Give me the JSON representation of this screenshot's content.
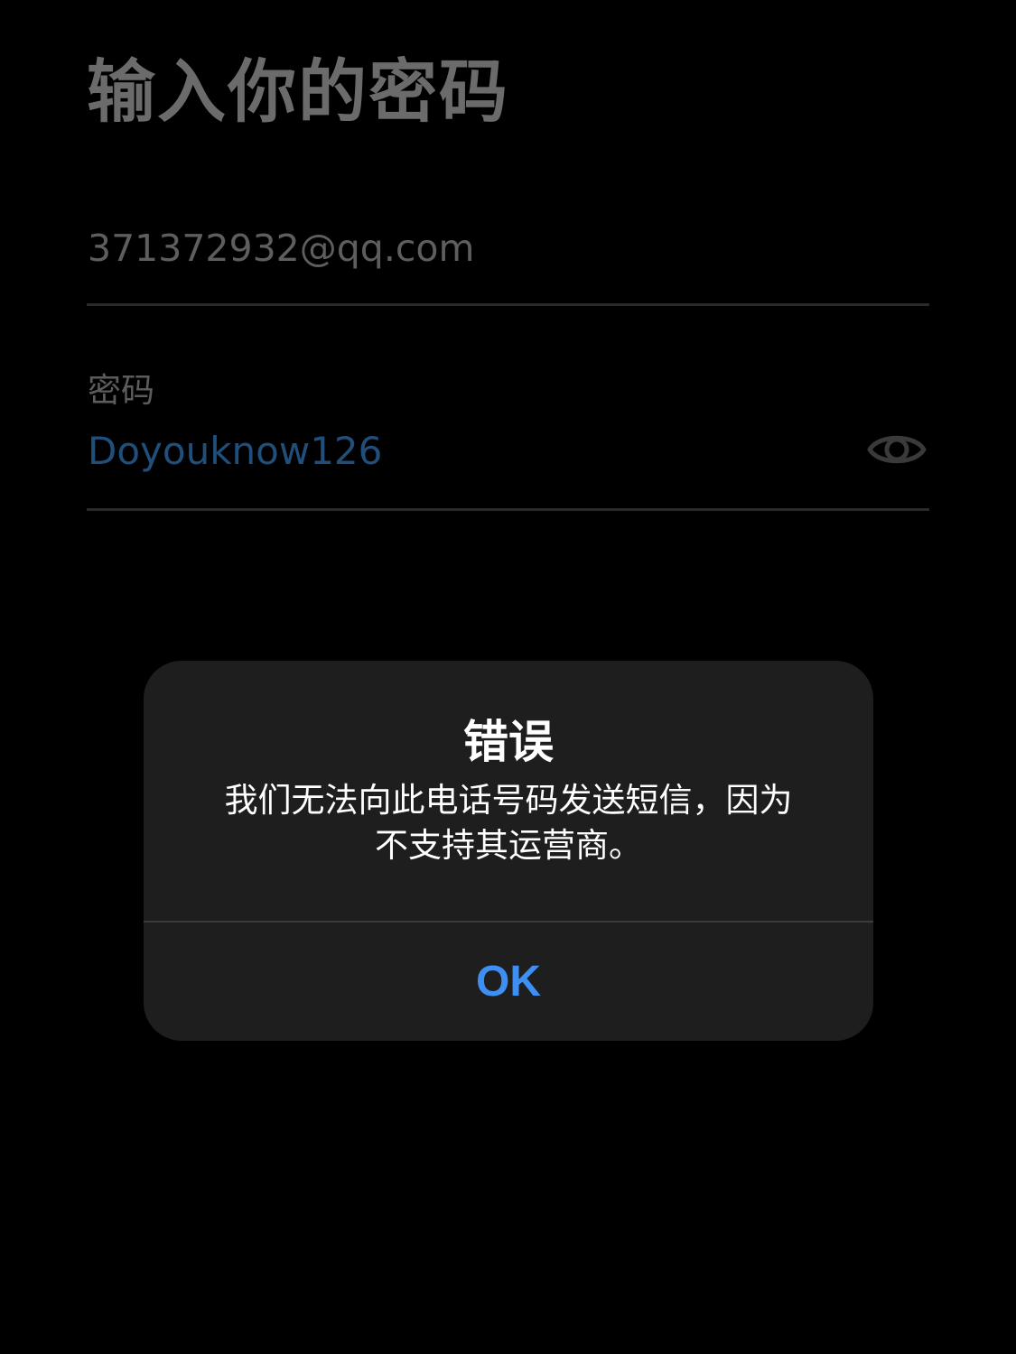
{
  "page": {
    "title": "输入你的密码"
  },
  "login": {
    "email_value": "371372932@qq.com",
    "password_label": "密码",
    "password_value": "Doyouknow126",
    "visibility_icon": "eye-icon"
  },
  "alert": {
    "title": "错误",
    "message_line1": "我们无法向此电话号码发送短信，因为",
    "message_line2": "不支持其运营商。",
    "ok_label": "OK"
  },
  "colors": {
    "background": "#000000",
    "alert_background": "#1e1e1e",
    "accent_blue": "#3d8ff4",
    "password_text": "#1f4f7a"
  }
}
